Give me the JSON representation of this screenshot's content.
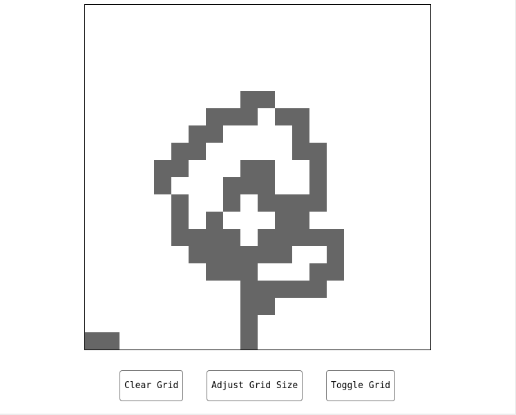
{
  "grid": {
    "rows": 20,
    "cols": 20,
    "fill_color": "#666666",
    "empty_color": "#ffffff",
    "border_color": "#000000",
    "filled_cells": [
      [
        5,
        9
      ],
      [
        5,
        10
      ],
      [
        6,
        7
      ],
      [
        6,
        8
      ],
      [
        6,
        9
      ],
      [
        6,
        11
      ],
      [
        6,
        12
      ],
      [
        7,
        6
      ],
      [
        7,
        7
      ],
      [
        7,
        12
      ],
      [
        8,
        5
      ],
      [
        8,
        6
      ],
      [
        8,
        12
      ],
      [
        8,
        13
      ],
      [
        9,
        4
      ],
      [
        9,
        5
      ],
      [
        9,
        9
      ],
      [
        9,
        10
      ],
      [
        9,
        13
      ],
      [
        10,
        4
      ],
      [
        10,
        8
      ],
      [
        10,
        9
      ],
      [
        10,
        10
      ],
      [
        10,
        13
      ],
      [
        11,
        5
      ],
      [
        11,
        8
      ],
      [
        11,
        10
      ],
      [
        11,
        11
      ],
      [
        11,
        12
      ],
      [
        11,
        13
      ],
      [
        12,
        5
      ],
      [
        12,
        7
      ],
      [
        12,
        11
      ],
      [
        12,
        12
      ],
      [
        13,
        5
      ],
      [
        13,
        6
      ],
      [
        13,
        7
      ],
      [
        13,
        8
      ],
      [
        13,
        10
      ],
      [
        13,
        11
      ],
      [
        13,
        12
      ],
      [
        13,
        13
      ],
      [
        13,
        14
      ],
      [
        14,
        6
      ],
      [
        14,
        7
      ],
      [
        14,
        8
      ],
      [
        14,
        9
      ],
      [
        14,
        10
      ],
      [
        14,
        11
      ],
      [
        14,
        14
      ],
      [
        15,
        7
      ],
      [
        15,
        8
      ],
      [
        15,
        9
      ],
      [
        15,
        13
      ],
      [
        15,
        14
      ],
      [
        16,
        9
      ],
      [
        16,
        10
      ],
      [
        16,
        11
      ],
      [
        16,
        12
      ],
      [
        16,
        13
      ],
      [
        17,
        9
      ],
      [
        17,
        10
      ],
      [
        18,
        9
      ],
      [
        19,
        0
      ],
      [
        19,
        1
      ],
      [
        19,
        9
      ]
    ]
  },
  "controls": {
    "clear_label": "Clear Grid",
    "adjust_label": "Adjust Grid Size",
    "toggle_label": "Toggle Grid"
  }
}
